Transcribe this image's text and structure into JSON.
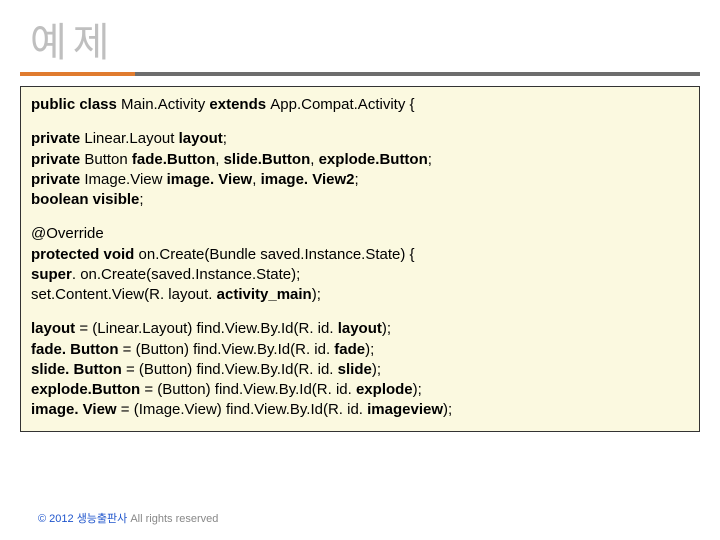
{
  "title": "예제",
  "code": {
    "l1a": "public class ",
    "l1b": "Main.Activity ",
    "l1c": "extends ",
    "l1d": "App.Compat.Activity {",
    "l2a": "private ",
    "l2b": "Linear.Layout ",
    "l2c": "layout",
    "l2d": ";",
    "l3a": "private ",
    "l3b": "Button ",
    "l3c": "fade.Button",
    "l3d": ", ",
    "l3e": "slide.Button",
    "l3f": ", ",
    "l3g": "explode.Button",
    "l3h": ";",
    "l4a": "private ",
    "l4b": "Image.View ",
    "l4c": "image. View",
    "l4d": ", ",
    "l4e": "image. View2",
    "l4f": ";",
    "l5a": "boolean ",
    "l5b": "visible",
    "l5c": ";",
    "l6a": "@Override",
    "l7a": "protected void ",
    "l7b": "on.Create(Bundle saved.Instance.State) {",
    "l8a": "super",
    "l8b": ". on.Create(saved.Instance.State);",
    "l9a": "set.Content.View(R. layout. ",
    "l9b": "activity_main",
    "l9c": ");",
    "l10a": "layout ",
    "l10b": "= (Linear.Layout) find.View.By.Id(R. id. ",
    "l10c": "layout",
    "l10d": ");",
    "l11a": "fade. Button ",
    "l11b": "= (Button) find.View.By.Id(R. id. ",
    "l11c": "fade",
    "l11d": ");",
    "l12a": "slide. Button ",
    "l12b": "= (Button) find.View.By.Id(R. id. ",
    "l12c": "slide",
    "l12d": ");",
    "l13a": "explode.Button ",
    "l13b": "= (Button) find.View.By.Id(R. id. ",
    "l13c": "explode",
    "l13d": ");",
    "l14a": "image. View ",
    "l14b": "= (Image.View) find.View.By.Id(R. id. ",
    "l14c": "imageview",
    "l14d": ");"
  },
  "footer": {
    "copy": "© 2012 생능출판사 ",
    "rest": "All rights reserved"
  }
}
